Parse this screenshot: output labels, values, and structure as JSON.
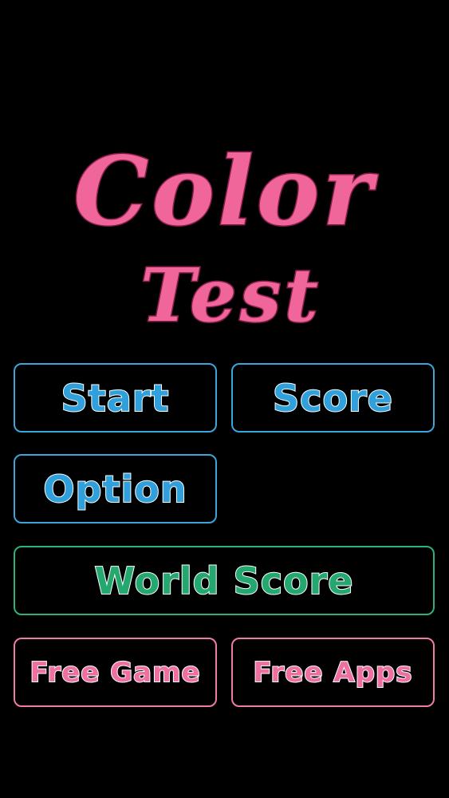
{
  "title": {
    "line1": "Color",
    "line2": "Test"
  },
  "menu": {
    "start": "Start",
    "score": "Score",
    "option": "Option",
    "world_score": "World Score",
    "free_game": "Free Game",
    "free_apps": "Free Apps"
  },
  "colors": {
    "background": "#000000",
    "title_pink": "#f0659a",
    "blue_accent": "#3aa6da",
    "green_accent": "#2fb27a",
    "pink_accent": "#f07aa8"
  }
}
